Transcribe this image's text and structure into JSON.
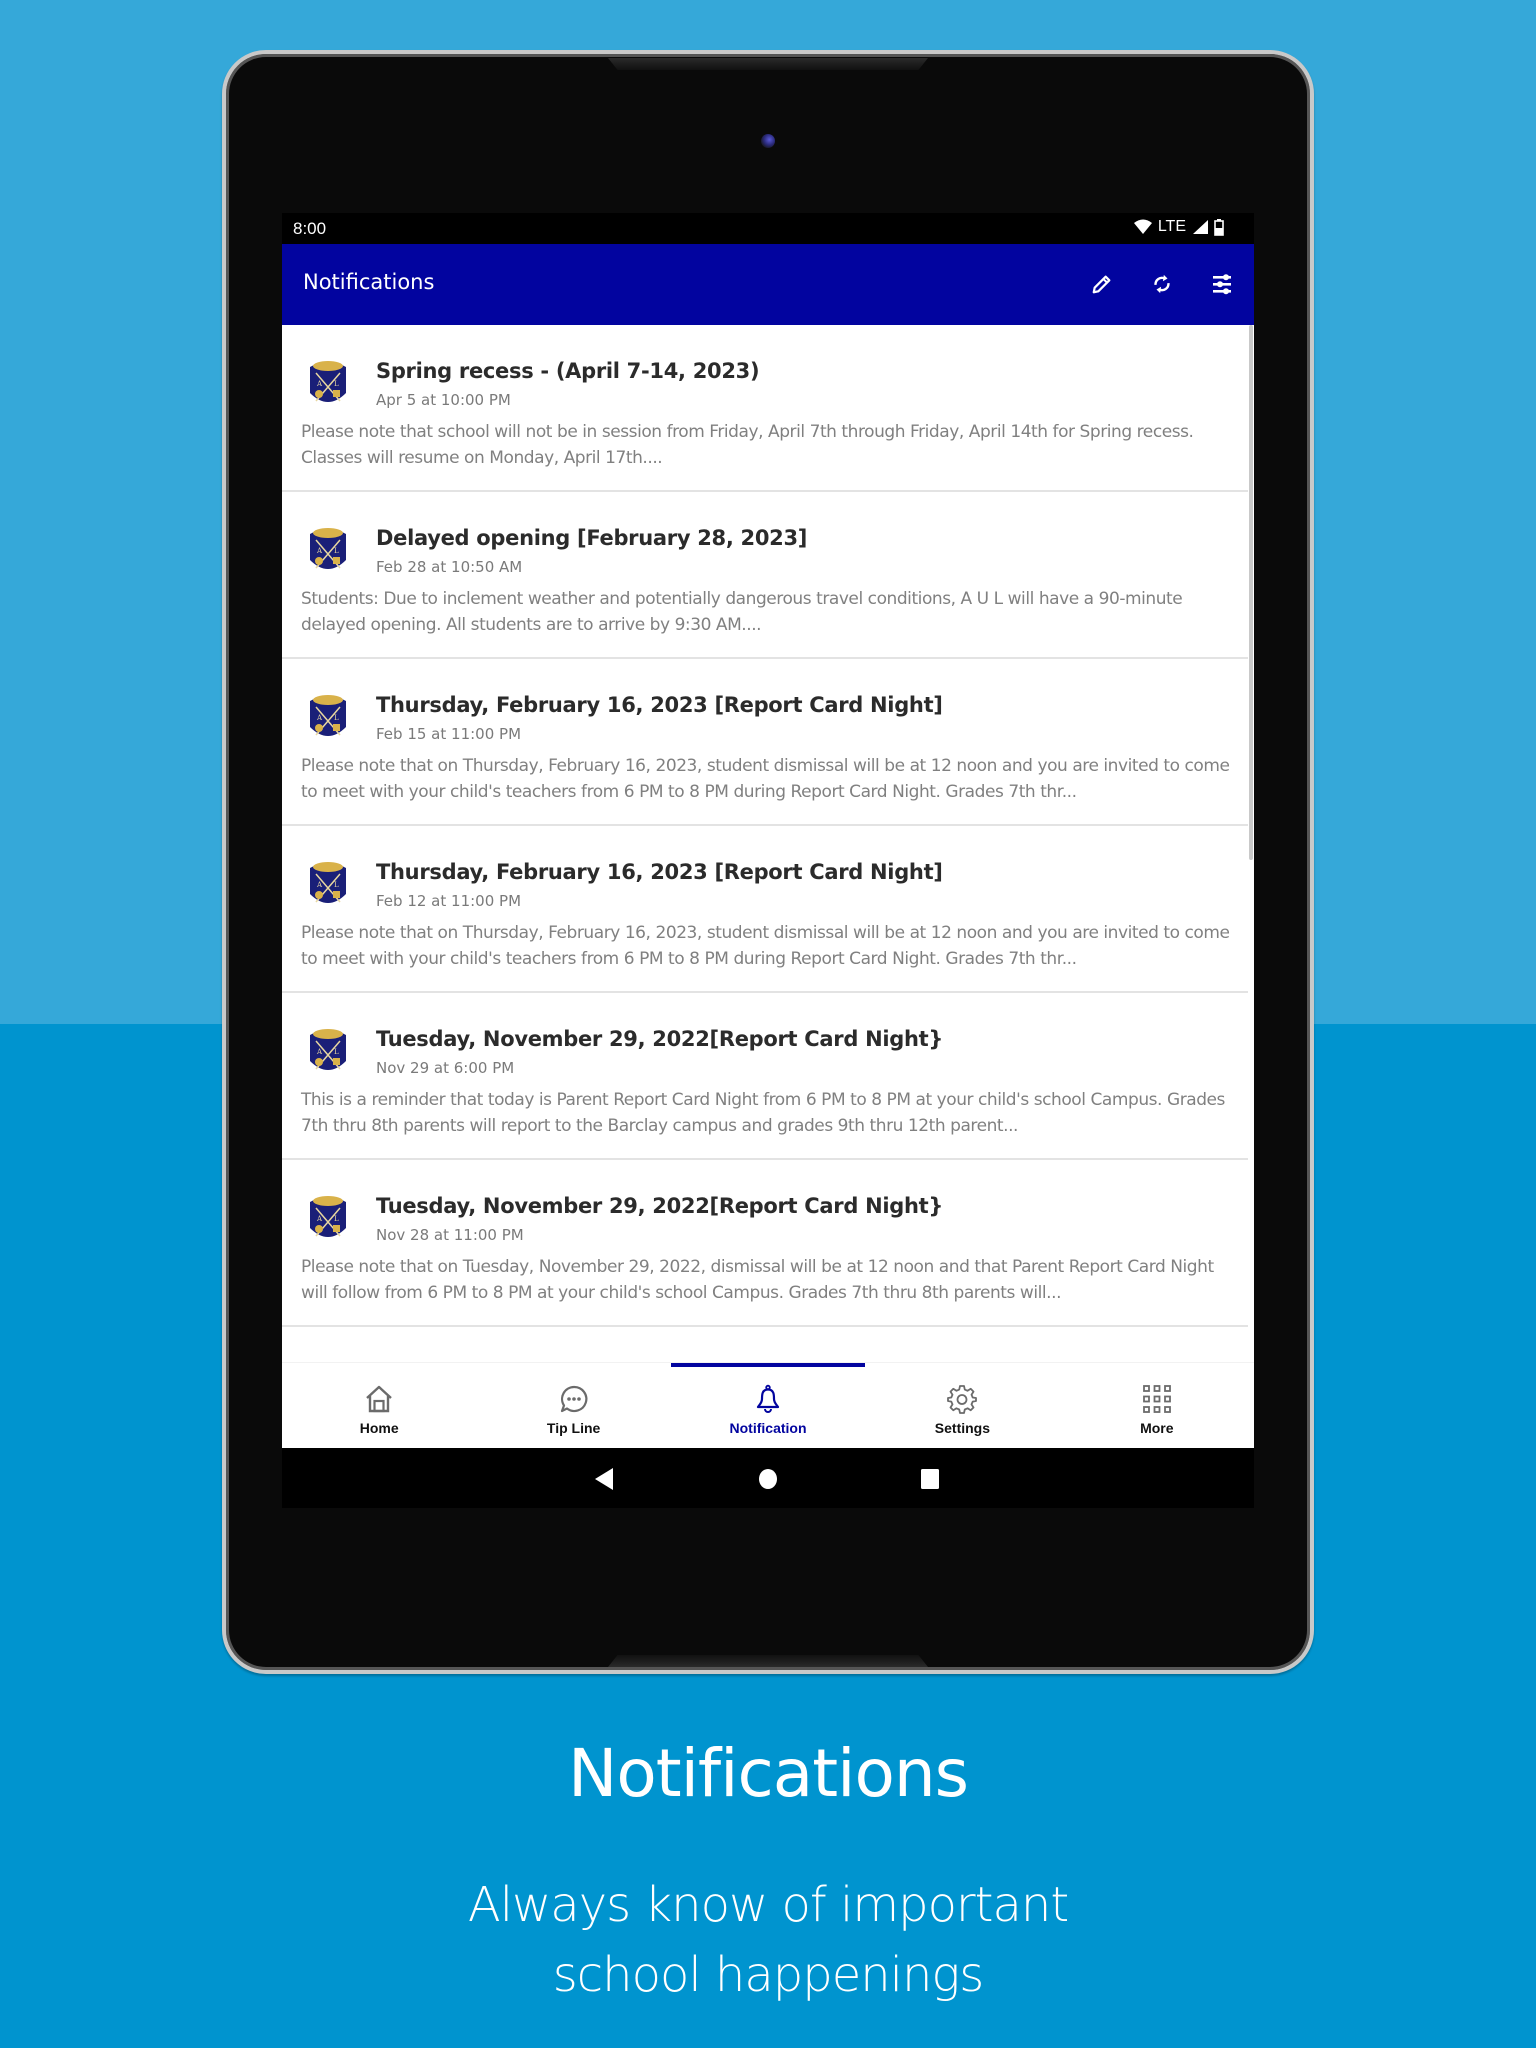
{
  "status_bar": {
    "time": "8:00",
    "network": "LTE",
    "icons": [
      "wifi-icon",
      "signal-icon",
      "battery-icon"
    ]
  },
  "app_bar": {
    "title": "Notifications",
    "actions": [
      "edit-icon",
      "refresh-icon",
      "filter-icon"
    ]
  },
  "notifications": [
    {
      "title": "Spring recess - (April 7-14, 2023)",
      "date": "Apr 5 at 10:00 PM",
      "body": "Please note that school will not be in session from Friday, April 7th through Friday, April 14th for Spring recess. Classes will resume on Monday, April 17th...."
    },
    {
      "title": "Delayed opening [February 28, 2023]",
      "date": "Feb 28 at 10:50 AM",
      "body": "Students: Due to inclement weather and potentially dangerous travel conditions, A U L will have a 90-minute delayed opening. All students are to arrive by 9:30 AM...."
    },
    {
      "title": "Thursday, February 16, 2023 [Report Card Night]",
      "date": "Feb 15 at 11:00 PM",
      "body": "Please note that on Thursday, February 16, 2023, student dismissal will be at 12 noon and you are invited to come to meet with your child's teachers from 6 PM to 8 PM during Report Card Night. Grades 7th thr..."
    },
    {
      "title": "Thursday, February 16, 2023 [Report Card Night]",
      "date": "Feb 12 at 11:00 PM",
      "body": "Please note that on Thursday, February 16, 2023, student dismissal will be at 12 noon and you are invited to come to meet with your child's teachers from 6 PM to 8 PM during Report Card Night. Grades 7th thr..."
    },
    {
      "title": "Tuesday, November 29, 2022[Report Card Night}",
      "date": "Nov 29 at 6:00 PM",
      "body": "This is a reminder that today is Parent Report Card Night from 6 PM to 8 PM at your child's school Campus. Grades 7th thru 8th parents will report to the Barclay campus and grades 9th thru 12th parent..."
    },
    {
      "title": "Tuesday, November 29, 2022[Report Card Night}",
      "date": "Nov 28 at 11:00 PM",
      "body": "Please note that on Tuesday, November 29, 2022, dismissal will be at 12 noon and that Parent Report Card Night will follow from 6 PM to 8 PM at your child's school Campus. Grades 7th thru 8th parents will..."
    }
  ],
  "bottom_nav": {
    "active_index": 2,
    "tabs": [
      {
        "label": "Home",
        "icon": "home-icon"
      },
      {
        "label": "Tip Line",
        "icon": "chat-bubble-icon"
      },
      {
        "label": "Notification",
        "icon": "bell-icon"
      },
      {
        "label": "Settings",
        "icon": "gear-icon"
      },
      {
        "label": "More",
        "icon": "grid-icon"
      }
    ]
  },
  "system_nav": [
    "back-icon",
    "home-circle-icon",
    "recents-icon"
  ],
  "colors": {
    "primary": "#02049F",
    "background_top": "#35A8D9",
    "background_bottom": "#0094CF"
  },
  "caption": {
    "title": "Notifications",
    "subtitle_line1": "Always know of important",
    "subtitle_line2": "school happenings"
  }
}
